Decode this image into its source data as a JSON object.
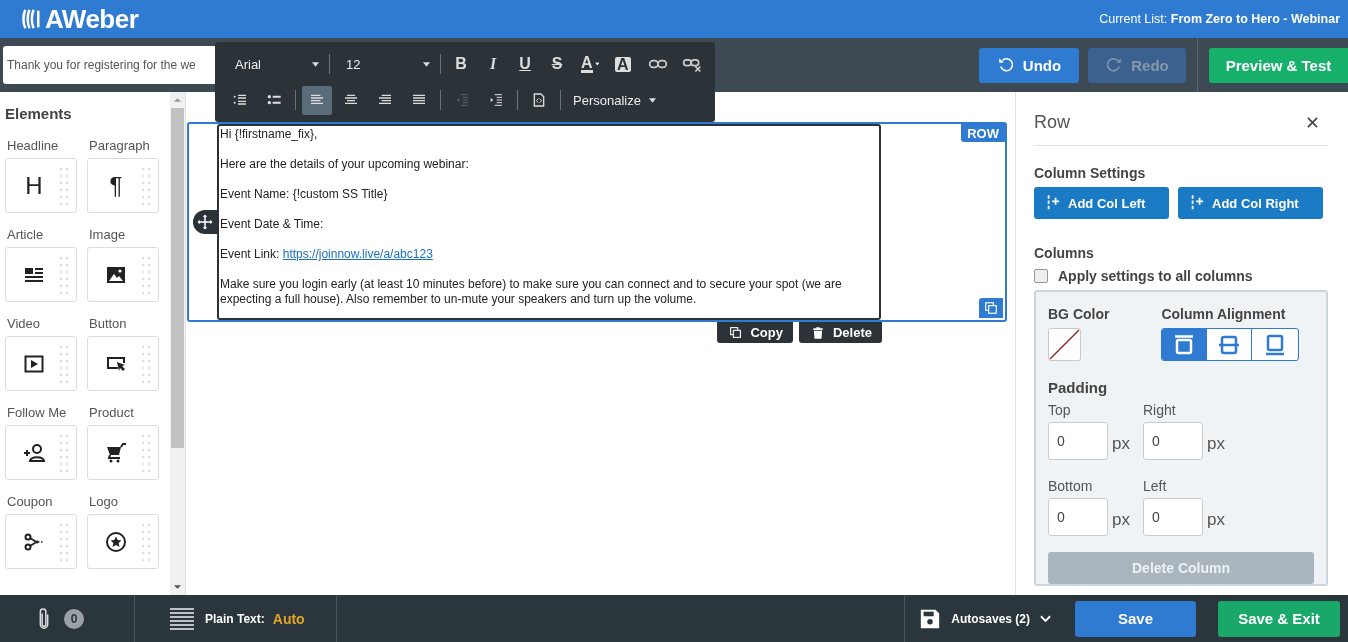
{
  "header": {
    "logo": "AWeber",
    "current_list": "Current List: **From Zero to Hero - Webinar**"
  },
  "top_bar": {
    "subject": {
      "value": "Thank you for registering for the we"
    },
    "buttons": [
      {
        "label": "Undo",
        "kind": "undo",
        "disabled": false
      },
      {
        "label": "Redo",
        "kind": "redo",
        "disabled": true
      }
    ],
    "preview_button": "Preview & Test"
  },
  "text_toolbar": {
    "font": "Arial",
    "size": "12",
    "format_buttons": [
      {
        "kind": "bold",
        "label": "B"
      },
      {
        "kind": "italic",
        "label": "I"
      },
      {
        "kind": "underline",
        "label": "U"
      },
      {
        "kind": "strike",
        "label": "S"
      },
      {
        "kind": "text_color",
        "label": "A"
      },
      {
        "kind": "bg_color",
        "label": "A"
      },
      {
        "kind": "link"
      },
      {
        "kind": "unlink"
      }
    ],
    "paragraph_buttons": [
      {
        "kind": "ordered_list",
        "selected": false,
        "disabled": false
      },
      {
        "kind": "bullet_list",
        "selected": false,
        "disabled": false
      },
      {
        "kind": "align_left",
        "selected": true,
        "disabled": false
      },
      {
        "kind": "align_center",
        "selected": false,
        "disabled": false
      },
      {
        "kind": "align_right",
        "selected": false,
        "disabled": false
      },
      {
        "kind": "justify",
        "selected": false,
        "disabled": false
      },
      {
        "kind": "outdent",
        "selected": false,
        "disabled": true
      },
      {
        "kind": "indent",
        "selected": false,
        "disabled": false
      },
      {
        "kind": "source",
        "selected": false,
        "disabled": false
      }
    ],
    "personalize": "Personalize"
  },
  "sidebar": {
    "title": "Elements",
    "items": [
      {
        "label": "Headline",
        "glyph": "H"
      },
      {
        "label": "Paragraph",
        "glyph": "¶"
      },
      {
        "label": "Article",
        "kind": "article"
      },
      {
        "label": "Image",
        "kind": "image"
      },
      {
        "label": "Video",
        "kind": "video"
      },
      {
        "label": "Button",
        "kind": "button"
      },
      {
        "label": "Follow Me",
        "kind": "follow"
      },
      {
        "label": "Product",
        "kind": "product"
      },
      {
        "label": "Coupon",
        "kind": "coupon"
      },
      {
        "label": "Logo",
        "kind": "logo"
      }
    ]
  },
  "email": {
    "row_tag": "ROW",
    "paragraphs": [
      {
        "text": "Hi {!firstname_fix},"
      },
      {
        "text": "Here are the details of your upcoming webinar:"
      },
      {
        "text": "Event Name: {!custom SS Title}"
      },
      {
        "text": "Event Date & Time:"
      },
      {
        "text": "Event Link:",
        "link": "https://joinnow.live/a/abc123"
      },
      {
        "text": "Make sure you login early (at least 10 minutes before) to make sure you can connect and to secure your spot (we are expecting a full house). Also remember to un-mute your speakers and turn up the volume."
      }
    ],
    "actions": [
      {
        "label": "Copy",
        "kind": "copy"
      },
      {
        "label": "Delete",
        "kind": "delete"
      }
    ]
  },
  "panel": {
    "title": "Row",
    "section": "Column Settings",
    "add_buttons": [
      "Add Col Left",
      "Add Col Right"
    ],
    "columns_label": "Columns",
    "apply_all": {
      "label": "Apply settings to all columns",
      "checked": false
    },
    "bg_color_label": "BG Color",
    "alignment_label": "Column Alignment",
    "alignments": [
      {
        "kind": "top",
        "selected": true
      },
      {
        "kind": "middle",
        "selected": false
      },
      {
        "kind": "bottom",
        "selected": false
      }
    ],
    "padding_label": "Padding",
    "padding": [
      {
        "label": "Top",
        "value": "0",
        "unit": "px"
      },
      {
        "label": "Right",
        "value": "0",
        "unit": "px"
      },
      {
        "label": "Bottom",
        "value": "0",
        "unit": "px"
      },
      {
        "label": "Left",
        "value": "0",
        "unit": "px"
      }
    ],
    "delete_button": {
      "label": "Delete Column",
      "disabled": true
    }
  },
  "footer": {
    "attachments": "0",
    "plain_text_label": "Plain Text:",
    "plain_text_value": "Auto",
    "autosaves": "Autosaves (2)",
    "buttons": [
      {
        "label": "Save",
        "kind": "save"
      },
      {
        "label": "Save & Exit",
        "kind": "save_exit"
      }
    ]
  }
}
